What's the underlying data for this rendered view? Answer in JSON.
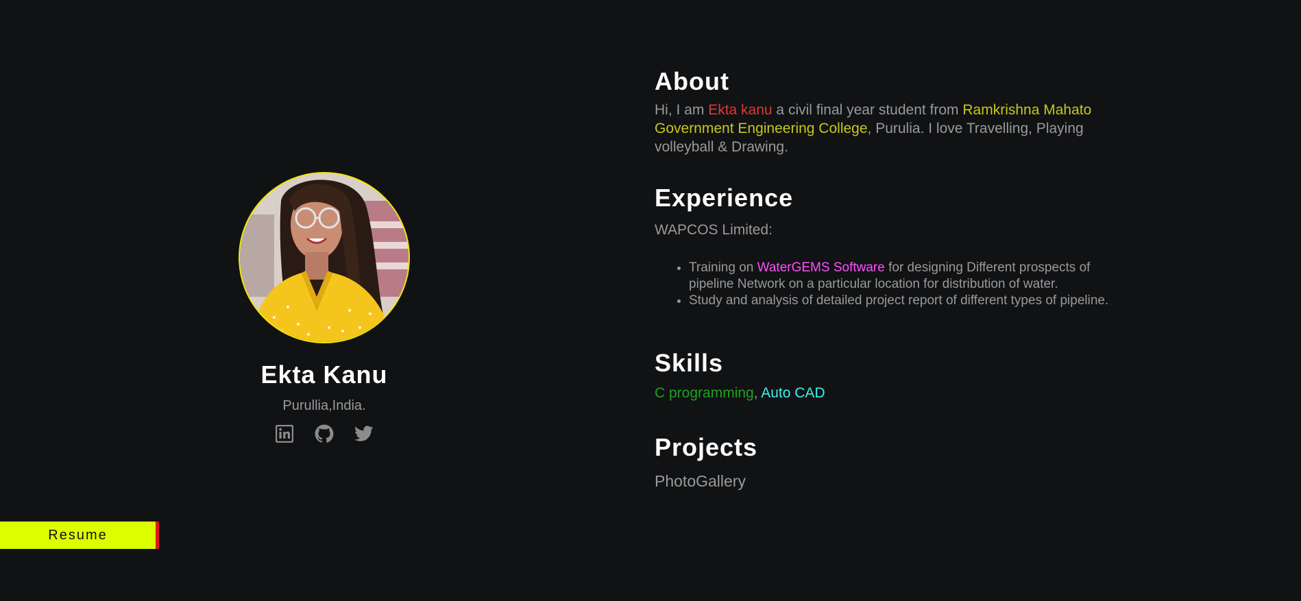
{
  "profile": {
    "name": "Ekta Kanu",
    "location": "Purullia,India.",
    "socials": [
      {
        "icon": "linkedin-icon"
      },
      {
        "icon": "github-icon"
      },
      {
        "icon": "twitter-icon"
      }
    ]
  },
  "resume_button": {
    "label": "Resume"
  },
  "about": {
    "title": "About",
    "intro": "Hi, I am ",
    "name_highlight": "Ekta kanu",
    "mid": " a civil final year student from ",
    "college_highlight": "Ramkrishna Mahato Government Engineering College",
    "outro": ", Purulia. I love Travelling, Playing volleyball & Drawing."
  },
  "experience": {
    "title": "Experience",
    "company": "WAPCOS Limited:",
    "items": [
      {
        "prefix": "Training on ",
        "highlight": "WaterGEMS Software",
        "suffix": " for designing Different prospects of pipeline Network on a particular location for distribution of water."
      },
      {
        "text": "Study and analysis of detailed project report of different types of pipeline."
      }
    ]
  },
  "skills": {
    "title": "Skills",
    "items": [
      "C programming",
      "Auto CAD"
    ],
    "separator": ", "
  },
  "projects": {
    "title": "Projects",
    "items": [
      "PhotoGallery"
    ]
  },
  "colors": {
    "background": "#111214",
    "avatar_border": "#f2e600",
    "resume_bg": "#dcff00",
    "resume_accent": "#e2161a",
    "name_highlight": "#e03a35",
    "college_highlight": "#c8c81c",
    "software_highlight": "#ff4fff",
    "skill_1": "#1ea21e",
    "skill_2": "#3ff0f0",
    "muted_text": "#9a9a9a"
  }
}
